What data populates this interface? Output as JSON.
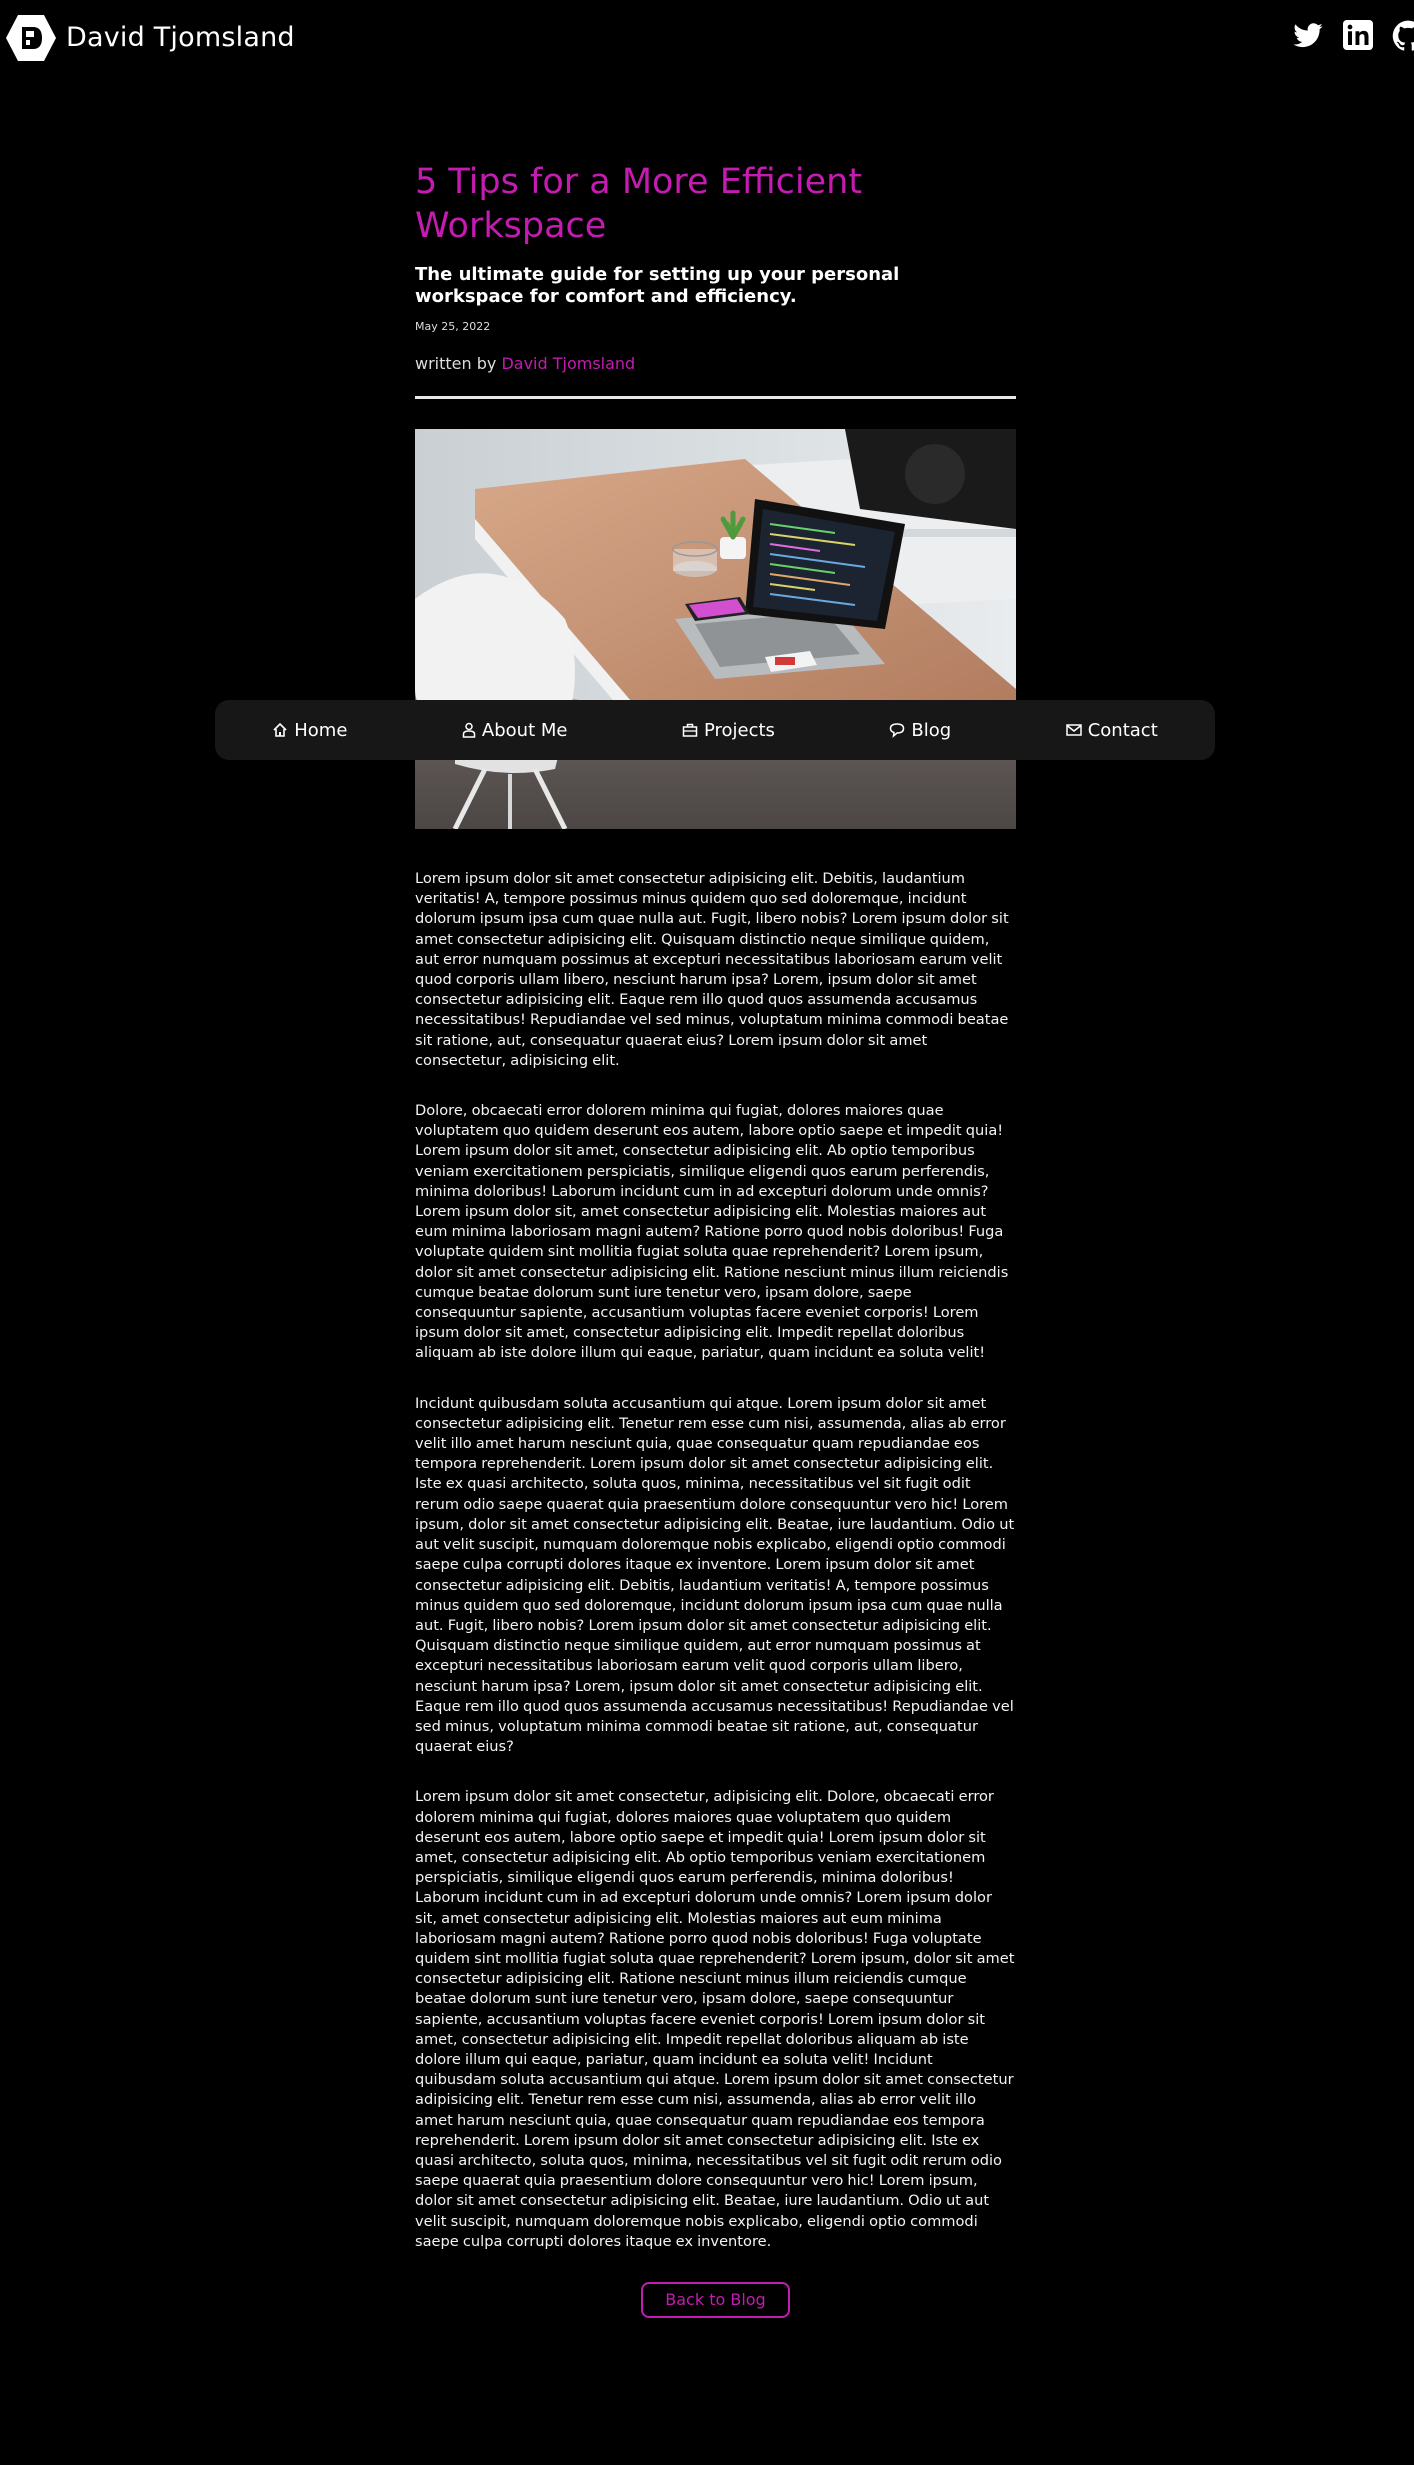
{
  "site": {
    "name": "David Tjomsland"
  },
  "social": [
    {
      "icon": "twitter-icon"
    },
    {
      "icon": "linkedin-icon"
    },
    {
      "icon": "github-icon"
    }
  ],
  "nav": {
    "items": [
      {
        "label": "Home",
        "icon": "home-icon"
      },
      {
        "label": "About Me",
        "icon": "user-icon"
      },
      {
        "label": "Projects",
        "icon": "briefcase-icon"
      },
      {
        "label": "Blog",
        "icon": "chat-icon"
      },
      {
        "label": "Contact",
        "icon": "mail-icon"
      }
    ]
  },
  "article": {
    "title": "5 Tips for a More Efficient Workspace",
    "subtitle": "The ultimate guide for setting up your personal workspace for comfort and efficiency.",
    "date": "May 25, 2022",
    "written_by": "written by",
    "author": "David Tjomsland",
    "paragraphs": [
      "Lorem ipsum dolor sit amet consectetur adipisicing elit. Debitis, laudantium veritatis! A, tempore possimus minus quidem quo sed doloremque, incidunt dolorum ipsum ipsa cum quae nulla aut. Fugit, libero nobis? Lorem ipsum dolor sit amet consectetur adipisicing elit. Quisquam distinctio neque similique quidem, aut error numquam possimus at excepturi necessitatibus laboriosam earum velit quod corporis ullam libero, nesciunt harum ipsa? Lorem, ipsum dolor sit amet consectetur adipisicing elit. Eaque rem illo quod quos assumenda accusamus necessitatibus! Repudiandae vel sed minus, voluptatum minima commodi beatae sit ratione, aut, consequatur quaerat eius? Lorem ipsum dolor sit amet consectetur, adipisicing elit.",
      "Dolore, obcaecati error dolorem minima qui fugiat, dolores maiores quae voluptatem quo quidem deserunt eos autem, labore optio saepe et impedit quia! Lorem ipsum dolor sit amet, consectetur adipisicing elit. Ab optio temporibus veniam exercitationem perspiciatis, similique eligendi quos earum perferendis, minima doloribus! Laborum incidunt cum in ad excepturi dolorum unde omnis? Lorem ipsum dolor sit, amet consectetur adipisicing elit. Molestias maiores aut eum minima laboriosam magni autem? Ratione porro quod nobis doloribus! Fuga voluptate quidem sint mollitia fugiat soluta quae reprehenderit? Lorem ipsum, dolor sit amet consectetur adipisicing elit. Ratione nesciunt minus illum reiciendis cumque beatae dolorum sunt iure tenetur vero, ipsam dolore, saepe consequuntur sapiente, accusantium voluptas facere eveniet corporis! Lorem ipsum dolor sit amet, consectetur adipisicing elit. Impedit repellat doloribus aliquam ab iste dolore illum qui eaque, pariatur, quam incidunt ea soluta velit!",
      "Incidunt quibusdam soluta accusantium qui atque. Lorem ipsum dolor sit amet consectetur adipisicing elit. Tenetur rem esse cum nisi, assumenda, alias ab error velit illo amet harum nesciunt quia, quae consequatur quam repudiandae eos tempora reprehenderit. Lorem ipsum dolor sit amet consectetur adipisicing elit. Iste ex quasi architecto, soluta quos, minima, necessitatibus vel sit fugit odit rerum odio saepe quaerat quia praesentium dolore consequuntur vero hic! Lorem ipsum, dolor sit amet consectetur adipisicing elit. Beatae, iure laudantium. Odio ut aut velit suscipit, numquam doloremque nobis explicabo, eligendi optio commodi saepe culpa corrupti dolores itaque ex inventore. Lorem ipsum dolor sit amet consectetur adipisicing elit. Debitis, laudantium veritatis! A, tempore possimus minus quidem quo sed doloremque, incidunt dolorum ipsum ipsa cum quae nulla aut. Fugit, libero nobis? Lorem ipsum dolor sit amet consectetur adipisicing elit. Quisquam distinctio neque similique quidem, aut error numquam possimus at excepturi necessitatibus laboriosam earum velit quod corporis ullam libero, nesciunt harum ipsa? Lorem, ipsum dolor sit amet consectetur adipisicing elit. Eaque rem illo quod quos assumenda accusamus necessitatibus! Repudiandae vel sed minus, voluptatum minima commodi beatae sit ratione, aut, consequatur quaerat eius?",
      "Lorem ipsum dolor sit amet consectetur, adipisicing elit. Dolore, obcaecati error dolorem minima qui fugiat, dolores maiores quae voluptatem quo quidem deserunt eos autem, labore optio saepe et impedit quia! Lorem ipsum dolor sit amet, consectetur adipisicing elit. Ab optio temporibus veniam exercitationem perspiciatis, similique eligendi quos earum perferendis, minima doloribus! Laborum incidunt cum in ad excepturi dolorum unde omnis? Lorem ipsum dolor sit, amet consectetur adipisicing elit. Molestias maiores aut eum minima laboriosam magni autem? Ratione porro quod nobis doloribus! Fuga voluptate quidem sint mollitia fugiat soluta quae reprehenderit? Lorem ipsum, dolor sit amet consectetur adipisicing elit. Ratione nesciunt minus illum reiciendis cumque beatae dolorum sunt iure tenetur vero, ipsam dolore, saepe consequuntur sapiente, accusantium voluptas facere eveniet corporis! Lorem ipsum dolor sit amet, consectetur adipisicing elit. Impedit repellat doloribus aliquam ab iste dolore illum qui eaque, pariatur, quam incidunt ea soluta velit! Incidunt quibusdam soluta accusantium qui atque. Lorem ipsum dolor sit amet consectetur adipisicing elit. Tenetur rem esse cum nisi, assumenda, alias ab error velit illo amet harum nesciunt quia, quae consequatur quam repudiandae eos tempora reprehenderit. Lorem ipsum dolor sit amet consectetur adipisicing elit. Iste ex quasi architecto, soluta quos, minima, necessitatibus vel sit fugit odit rerum odio saepe quaerat quia praesentium dolore consequuntur vero hic! Lorem ipsum, dolor sit amet consectetur adipisicing elit. Beatae, iure laudantium. Odio ut aut velit suscipit, numquam doloremque nobis explicabo, eligendi optio commodi saepe culpa corrupti dolores itaque ex inventore."
    ]
  },
  "back_button": {
    "label": "Back to Blog"
  },
  "colors": {
    "accent": "#c41bb1",
    "background": "#000000",
    "nav_background": "#171717"
  }
}
